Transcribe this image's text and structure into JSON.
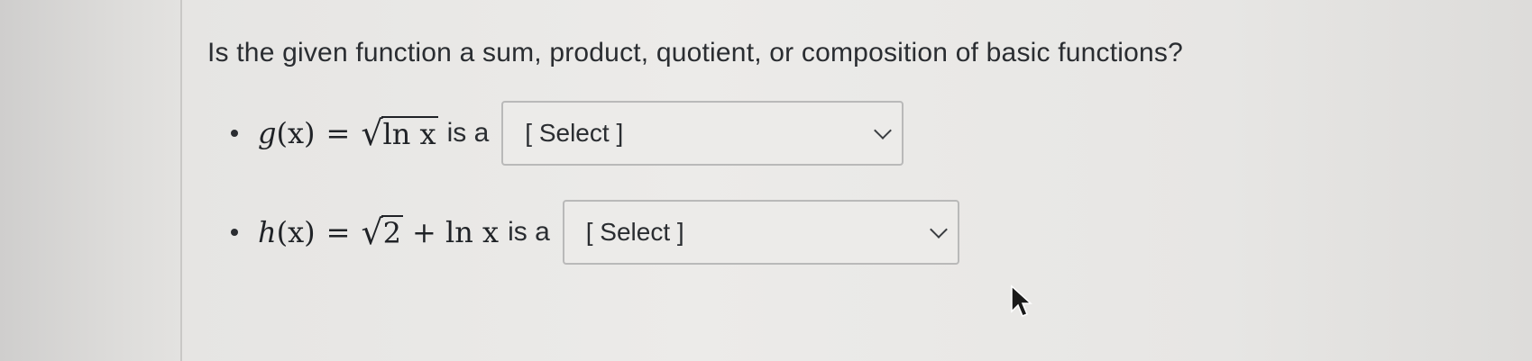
{
  "question": {
    "title": "Is the given function a sum, product, quotient, or composition of basic functions?"
  },
  "items": [
    {
      "func_name": "g",
      "lhs_arg": "(x)",
      "equals": "=",
      "expression": {
        "radicand": "ln x"
      },
      "connector": "is a",
      "select_value": "[ Select ]"
    },
    {
      "func_name": "h",
      "lhs_arg": "(x)",
      "equals": "=",
      "expression": {
        "radicand": "2",
        "tail": "+ ln x"
      },
      "connector": "is a",
      "select_value": "[ Select ]"
    }
  ],
  "icons": {
    "dropdown": "chevron-down-icon",
    "cursor": "mouse-pointer-icon"
  }
}
